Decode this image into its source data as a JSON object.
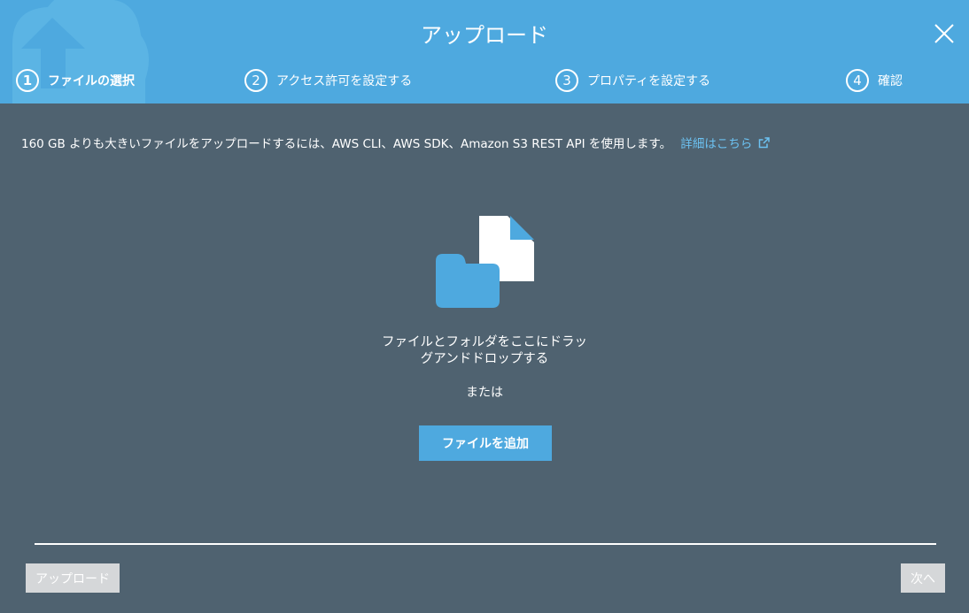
{
  "header": {
    "title": "アップロード",
    "steps": [
      {
        "num": "1",
        "label": "ファイルの選択",
        "active": true
      },
      {
        "num": "2",
        "label": "アクセス許可を設定する",
        "active": false
      },
      {
        "num": "3",
        "label": "プロパティを設定する",
        "active": false
      },
      {
        "num": "4",
        "label": "確認",
        "active": false
      }
    ],
    "close_icon": "close-icon"
  },
  "main": {
    "notice_text": "160 GB よりも大きいファイルをアップロードするには、AWS CLI、AWS SDK、Amazon S3 REST API を使用します。",
    "notice_link": "詳細はこちら",
    "drop_text_line1": "ファイルとフォルダをここにドラッ",
    "drop_text_line2": "グアンドドロップする",
    "or_text": "または",
    "add_button_label": "ファイルを追加"
  },
  "footer": {
    "upload_label": "アップロード",
    "next_label": "次へ"
  },
  "colors": {
    "header_bg": "#4ea9df",
    "body_bg": "#4f6270",
    "link": "#6cc2f2",
    "disabled_btn": "#d5d7d9"
  }
}
